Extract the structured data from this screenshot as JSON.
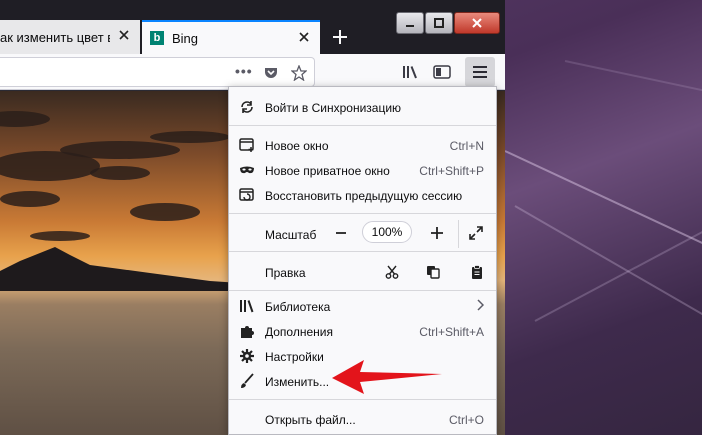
{
  "tabs": [
    {
      "title": "ак изменить цвет вкл"
    },
    {
      "title": "Bing",
      "favicon": "bing-icon",
      "active": true
    }
  ],
  "menu": {
    "sync": {
      "label": "Войти в Синхронизацию",
      "icon": "sync-icon"
    },
    "new_window": {
      "label": "Новое окно",
      "shortcut": "Ctrl+N",
      "icon": "new-window-icon"
    },
    "private_window": {
      "label": "Новое приватное окно",
      "shortcut": "Ctrl+Shift+P",
      "icon": "private-mask-icon"
    },
    "restore_session": {
      "label": "Восстановить предыдущую сессию",
      "icon": "restore-session-icon"
    },
    "zoom": {
      "label": "Масштаб",
      "value": "100%"
    },
    "edit": {
      "label": "Правка"
    },
    "library": {
      "label": "Библиотека",
      "icon": "library-icon"
    },
    "addons": {
      "label": "Дополнения",
      "shortcut": "Ctrl+Shift+A",
      "icon": "puzzle-icon"
    },
    "options": {
      "label": "Настройки",
      "icon": "gear-icon"
    },
    "customize": {
      "label": "Изменить...",
      "icon": "brush-icon"
    },
    "open_file": {
      "label": "Открыть файл...",
      "shortcut": "Ctrl+O"
    }
  },
  "colors": {
    "accent": "#0a84ff",
    "arrow": "#e3141b",
    "tab_active_border": "#0a84ff"
  }
}
